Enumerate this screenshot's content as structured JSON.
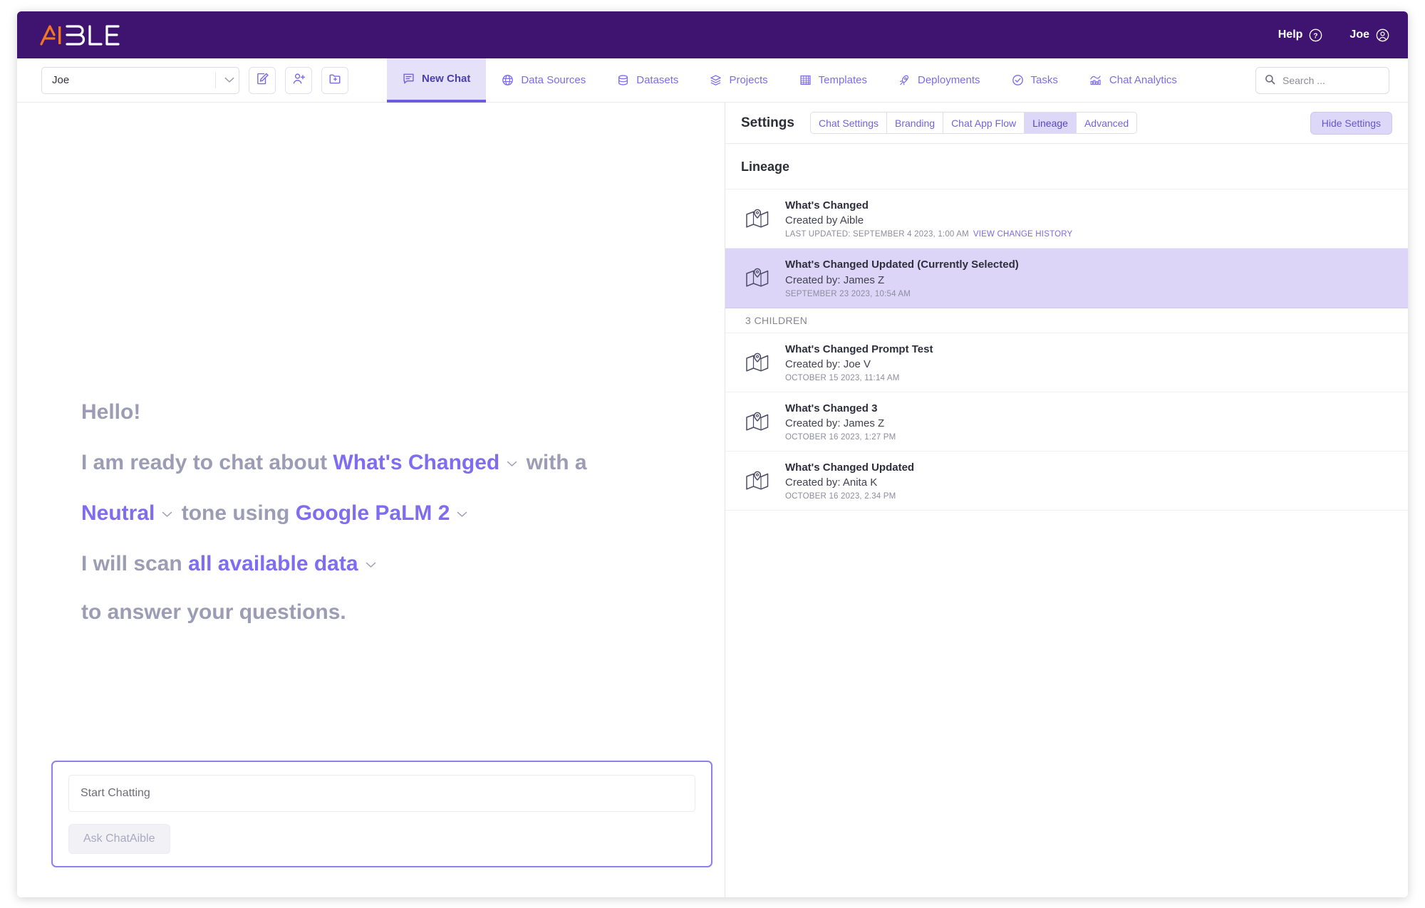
{
  "header": {
    "logo_text": "AIBLE",
    "help_label": "Help",
    "help_icon": "question-circle-icon",
    "user_label": "Joe",
    "user_icon": "user-circle-icon",
    "bg_color": "#3F1470"
  },
  "toolbar": {
    "project_value": "Joe",
    "caret_icon": "chevron-down-icon",
    "buttons": [
      {
        "name": "edit-icon",
        "label": "Edit"
      },
      {
        "name": "add-user-icon",
        "label": "Add User"
      },
      {
        "name": "new-folder-icon",
        "label": "New Folder"
      }
    ],
    "tabs": [
      {
        "label": "New Chat",
        "icon": "chat-icon",
        "active": true
      },
      {
        "label": "Data Sources",
        "icon": "globe-icon",
        "active": false
      },
      {
        "label": "Datasets",
        "icon": "database-icon",
        "active": false
      },
      {
        "label": "Projects",
        "icon": "layers-icon",
        "active": false
      },
      {
        "label": "Templates",
        "icon": "grid-icon",
        "active": false
      },
      {
        "label": "Deployments",
        "icon": "rocket-icon",
        "active": false
      },
      {
        "label": "Tasks",
        "icon": "check-circle-icon",
        "active": false
      },
      {
        "label": "Chat Analytics",
        "icon": "analytics-icon",
        "active": false
      }
    ],
    "search_placeholder": "Search ...",
    "search_icon": "search-icon"
  },
  "chat": {
    "greeting": "Hello!",
    "line2_pre": "I am ready to chat about",
    "topic": "What's Changed",
    "line2_post": "with a",
    "tone": "Neutral",
    "line3_mid": "tone using",
    "model": "Google PaLM 2",
    "line4_pre": "I will scan",
    "scope": "all available data",
    "line5": "to answer your questions.",
    "input_placeholder": "Start Chatting",
    "input_value": "",
    "submit_label": "Ask ChatAible",
    "accent_color": "#7e6df0"
  },
  "settings": {
    "title": "Settings",
    "tabs": [
      {
        "label": "Chat Settings",
        "active": false
      },
      {
        "label": "Branding",
        "active": false
      },
      {
        "label": "Chat App Flow",
        "active": false
      },
      {
        "label": "Lineage",
        "active": true
      },
      {
        "label": "Advanced",
        "active": false
      }
    ],
    "hide_label": "Hide Settings",
    "section_title": "Lineage",
    "children_header": "3 CHILDREN",
    "selected_bg": "#dcd5f7",
    "items": [
      {
        "icon": "map-pin-icon",
        "name": "What's Changed",
        "creator": "Created by Aible",
        "meta": "LAST UPDATED: SEPTEMBER 4 2023, 1:00 AM",
        "link": "VIEW CHANGE HISTORY",
        "selected": false,
        "child": false
      },
      {
        "icon": "map-pin-icon",
        "name": "What's Changed Updated (Currently Selected)",
        "creator": "Created by: James Z",
        "meta": "SEPTEMBER 23 2023, 10:54 AM",
        "link": "",
        "selected": true,
        "child": false
      },
      {
        "icon": "map-pin-icon",
        "name": "What's Changed Prompt Test",
        "creator": "Created by: Joe V",
        "meta": "OCTOBER 15 2023, 11:14 AM",
        "link": "",
        "selected": false,
        "child": true
      },
      {
        "icon": "map-pin-icon",
        "name": "What's Changed 3",
        "creator": "Created by: James Z",
        "meta": "OCTOBER 16 2023, 1:27 PM",
        "link": "",
        "selected": false,
        "child": true
      },
      {
        "icon": "map-pin-icon",
        "name": "What's Changed Updated",
        "creator": "Created by: Anita K",
        "meta": "OCTOBER 16 2023, 2.34 PM",
        "link": "",
        "selected": false,
        "child": true
      }
    ]
  }
}
